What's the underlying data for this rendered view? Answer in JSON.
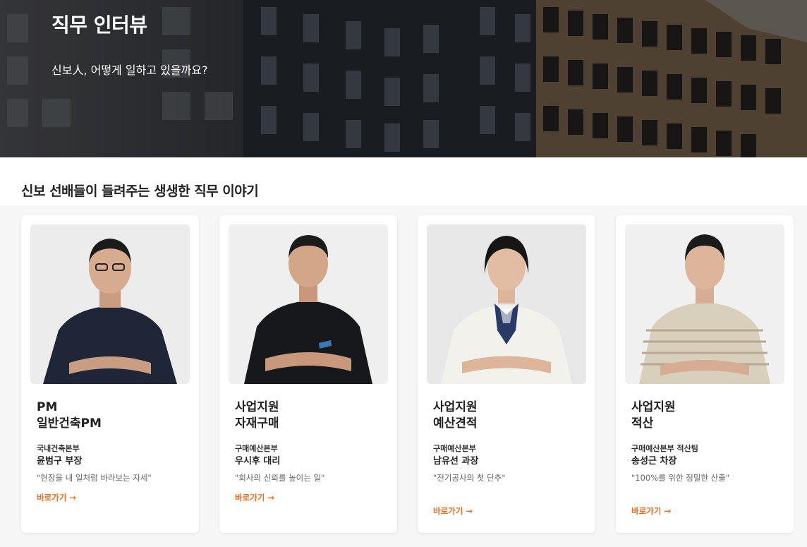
{
  "hero": {
    "title": "직무 인터뷰",
    "subtitle": "신보人, 어떻게 일하고 있을까요?"
  },
  "section": {
    "heading": "신보 선배들이 들려주는 생생한 직무 이야기"
  },
  "cards": [
    {
      "role_line1": "PM",
      "role_line2": "일반건축PM",
      "department": "국내건축본부",
      "name": "윤범구 부장",
      "quote": "\"현장을 내 일처럼 바라보는 자세\"",
      "link": "바로가기 →",
      "shirt_color": "#1f2638"
    },
    {
      "role_line1": "사업지원",
      "role_line2": "자재구매",
      "department": "구매예산본부",
      "name": "우시후 대리",
      "quote": "\"회사의 신뢰를 높이는 일\"",
      "link": "바로가기 →",
      "shirt_color": "#17181b"
    },
    {
      "role_line1": "사업지원",
      "role_line2": "예산견적",
      "department": "구매예산본부",
      "name": "남유선 과장",
      "quote": "\"전기공사의 첫 단추\"",
      "link": "바로가기 →",
      "shirt_color": "#f3f1ec"
    },
    {
      "role_line1": "사업지원",
      "role_line2": "적산",
      "department": "구매예산본부 적산팀",
      "name": "송성근 차장",
      "quote": "\"100%를 위한 정밀한 산출\"",
      "link": "바로가기 →",
      "shirt_color": "#d9cfbd"
    }
  ]
}
